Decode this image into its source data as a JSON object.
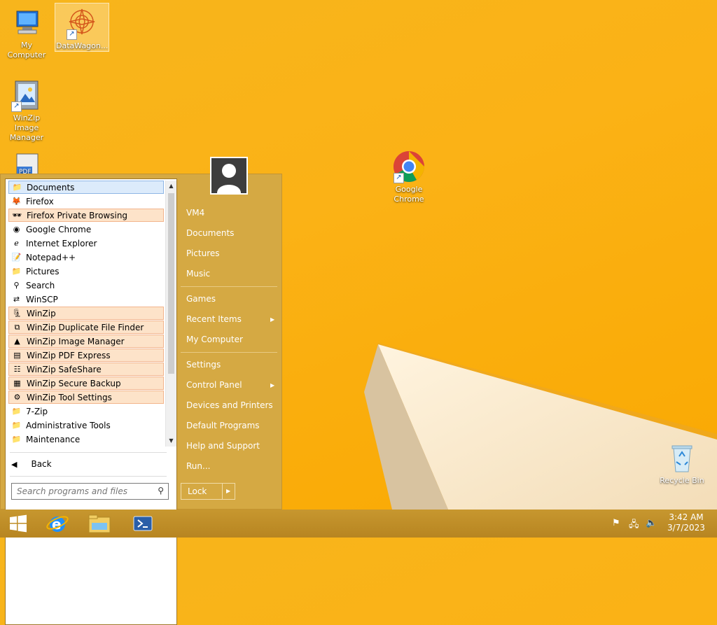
{
  "desktop": {
    "icons": [
      {
        "label": "My Computer",
        "icon": "computer-icon"
      },
      {
        "label": "DataWagon...",
        "icon": "datawagon-icon"
      },
      {
        "label": "WinZip Image Manager",
        "icon": "winzip-image-manager-icon"
      },
      {
        "label": "Google Chrome",
        "icon": "chrome-icon"
      },
      {
        "label": "Recycle Bin",
        "icon": "recycle-bin-icon"
      }
    ]
  },
  "start_menu": {
    "programs": [
      {
        "label": "Documents",
        "icon": "folder-icon",
        "state": "selected"
      },
      {
        "label": "Firefox",
        "icon": "firefox-icon"
      },
      {
        "label": "Firefox Private Browsing",
        "icon": "firefox-private-icon",
        "state": "new"
      },
      {
        "label": "Google Chrome",
        "icon": "chrome-icon"
      },
      {
        "label": "Internet Explorer",
        "icon": "ie-icon"
      },
      {
        "label": "Notepad++",
        "icon": "notepad-icon"
      },
      {
        "label": "Pictures",
        "icon": "folder-icon"
      },
      {
        "label": "Search",
        "icon": "search-icon"
      },
      {
        "label": "WinSCP",
        "icon": "winscp-icon"
      },
      {
        "label": "WinZip",
        "icon": "winzip-icon",
        "state": "new"
      },
      {
        "label": "WinZip Duplicate File Finder",
        "icon": "duplicate-finder-icon",
        "state": "new"
      },
      {
        "label": "WinZip Image Manager",
        "icon": "image-manager-icon",
        "state": "new"
      },
      {
        "label": "WinZip PDF Express",
        "icon": "pdf-icon",
        "state": "new"
      },
      {
        "label": "WinZip SafeShare",
        "icon": "safeshare-icon",
        "state": "new"
      },
      {
        "label": "WinZip Secure Backup",
        "icon": "backup-icon",
        "state": "new"
      },
      {
        "label": "WinZip Tool Settings",
        "icon": "tool-settings-icon",
        "state": "new"
      },
      {
        "label": "7-Zip",
        "icon": "folder-icon"
      },
      {
        "label": "Administrative Tools",
        "icon": "folder-icon"
      },
      {
        "label": "Maintenance",
        "icon": "folder-icon"
      }
    ],
    "back_label": "Back",
    "search_placeholder": "Search programs and files",
    "right_links": [
      {
        "label": "VM4"
      },
      {
        "label": "Documents"
      },
      {
        "label": "Pictures"
      },
      {
        "label": "Music"
      },
      {
        "label": "Games"
      },
      {
        "label": "Recent Items",
        "submenu": true
      },
      {
        "label": "My Computer"
      },
      {
        "label": "Settings"
      },
      {
        "label": "Control Panel",
        "submenu": true
      },
      {
        "label": "Devices and Printers"
      },
      {
        "label": "Default Programs"
      },
      {
        "label": "Help and Support"
      },
      {
        "label": "Run..."
      }
    ],
    "lock_label": "Lock"
  },
  "taskbar": {
    "pinned": [
      {
        "icon": "windows-start-icon"
      },
      {
        "icon": "internet-explorer-icon"
      },
      {
        "icon": "file-explorer-icon"
      },
      {
        "icon": "powershell-icon"
      }
    ],
    "tray": [
      {
        "icon": "flag-icon"
      },
      {
        "icon": "network-icon"
      },
      {
        "icon": "speaker-icon"
      }
    ],
    "time": "3:42 AM",
    "date": "3/7/2023"
  }
}
